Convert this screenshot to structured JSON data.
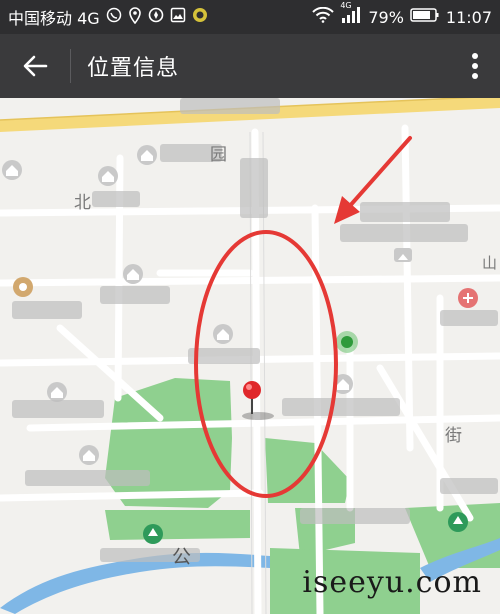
{
  "status_bar": {
    "carrier": "中国移动 4G",
    "network_badge": "4G",
    "battery": "79%",
    "time": "11:07",
    "icons": [
      "hd-call-icon",
      "location-icon",
      "compass-icon",
      "gallery-icon",
      "app-badge-icon",
      "wifi-icon",
      "signal-icon",
      "battery-icon"
    ]
  },
  "app_bar": {
    "title": "位置信息",
    "back_icon": "back-arrow-icon",
    "menu_icon": "more-vertical-icon"
  },
  "map": {
    "labels": {
      "l1": "园",
      "l2": "北",
      "l3": "山",
      "l4": "街",
      "l5": "公"
    },
    "colors": {
      "park": "#8fd08f",
      "water": "#7fb7e6",
      "main_road": "#f5d97a",
      "annotation": "#e53935",
      "pin": "#e0282b"
    }
  },
  "watermark": "iseeyu.com"
}
